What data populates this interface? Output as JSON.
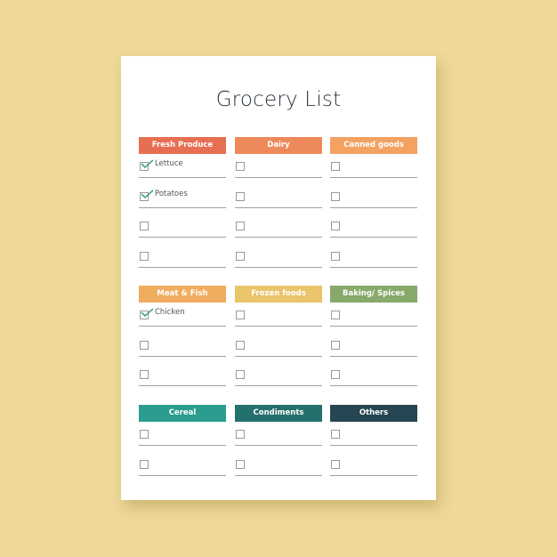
{
  "title": "Grocery List",
  "colors": {
    "background": "#efd898",
    "paper": "#ffffff",
    "check": "#2e9e6e"
  },
  "sections": [
    {
      "label": "Fresh Produce",
      "color": "#e76f51",
      "items": [
        {
          "text": "Lettuce",
          "checked": true
        },
        {
          "text": "Potatoes",
          "checked": true
        },
        {
          "text": "",
          "checked": false
        },
        {
          "text": "",
          "checked": false
        }
      ]
    },
    {
      "label": "Dairy",
      "color": "#ee8a5a",
      "items": [
        {
          "text": "",
          "checked": false
        },
        {
          "text": "",
          "checked": false
        },
        {
          "text": "",
          "checked": false
        },
        {
          "text": "",
          "checked": false
        }
      ]
    },
    {
      "label": "Canned goods",
      "color": "#f4a261",
      "items": [
        {
          "text": "",
          "checked": false
        },
        {
          "text": "",
          "checked": false
        },
        {
          "text": "",
          "checked": false
        },
        {
          "text": "",
          "checked": false
        }
      ]
    },
    {
      "label": "Meat & Fish",
      "color": "#f0ad60",
      "items": [
        {
          "text": "Chicken",
          "checked": true
        },
        {
          "text": "",
          "checked": false
        },
        {
          "text": "",
          "checked": false
        }
      ]
    },
    {
      "label": "Frozen foods",
      "color": "#e9c46a",
      "items": [
        {
          "text": "",
          "checked": false
        },
        {
          "text": "",
          "checked": false
        },
        {
          "text": "",
          "checked": false
        }
      ]
    },
    {
      "label": "Baking/ Spices",
      "color": "#87a96b",
      "items": [
        {
          "text": "",
          "checked": false
        },
        {
          "text": "",
          "checked": false
        },
        {
          "text": "",
          "checked": false
        }
      ]
    },
    {
      "label": "Cereal",
      "color": "#2a9d8f",
      "items": [
        {
          "text": "",
          "checked": false
        },
        {
          "text": "",
          "checked": false
        }
      ]
    },
    {
      "label": "Condiments",
      "color": "#24706c",
      "items": [
        {
          "text": "",
          "checked": false
        },
        {
          "text": "",
          "checked": false
        }
      ]
    },
    {
      "label": "Others",
      "color": "#264653",
      "items": [
        {
          "text": "",
          "checked": false
        },
        {
          "text": "",
          "checked": false
        }
      ]
    }
  ]
}
